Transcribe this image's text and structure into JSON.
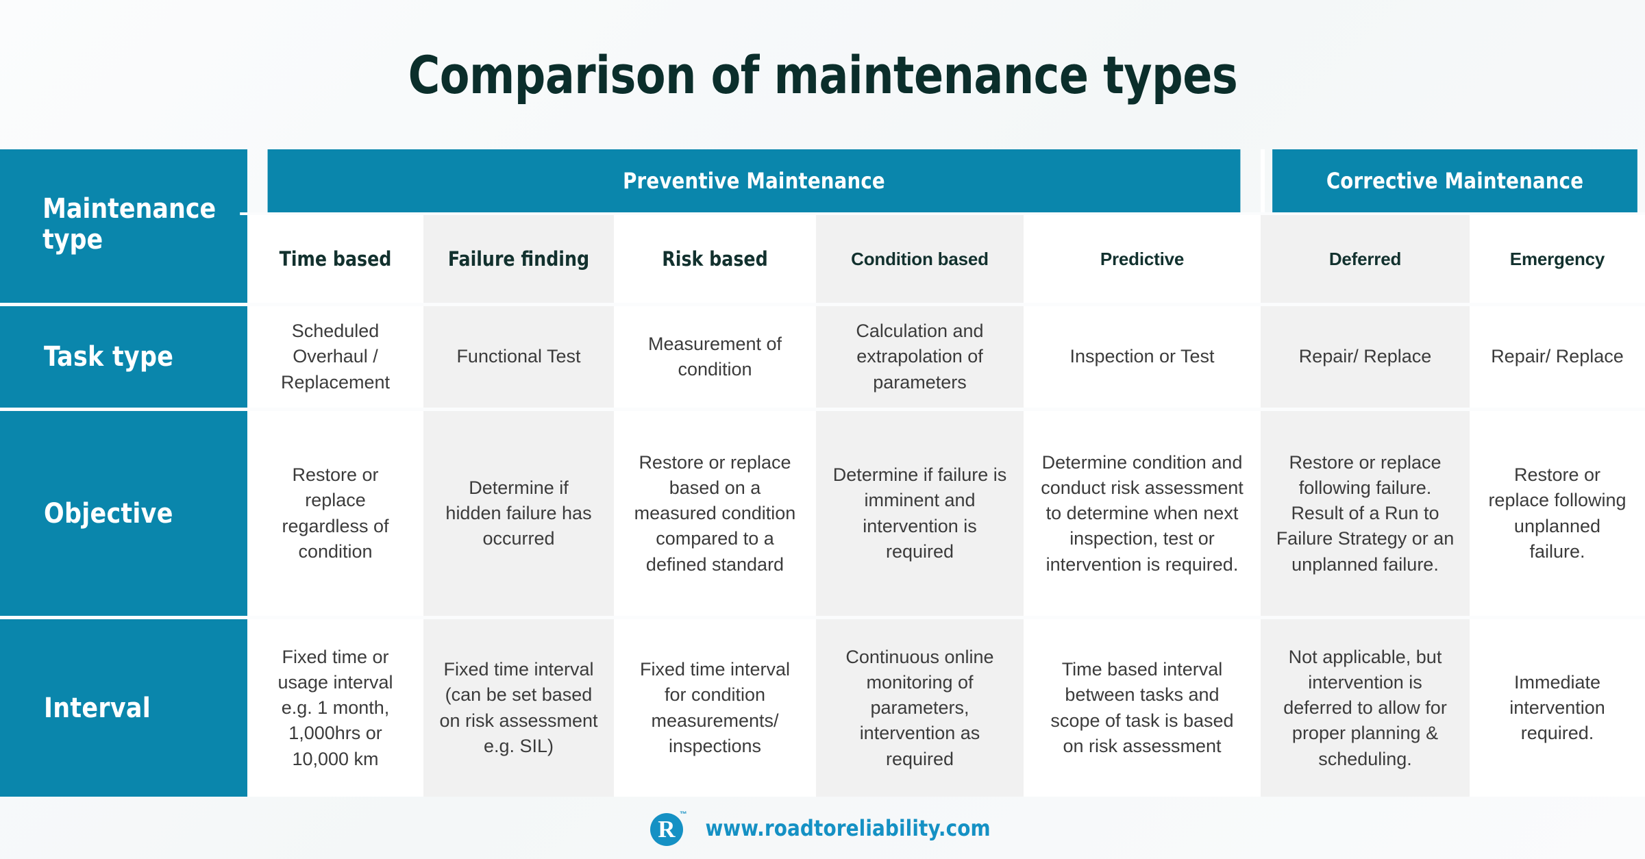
{
  "title": "Comparison of maintenance types",
  "colors": {
    "teal": "#0a86ac",
    "title_text": "#0b2e2b",
    "cell_text": "#3b3b3b",
    "stripe_gray": "#f1f1f1",
    "page_bg": "#f7f9fa",
    "link_blue": "#1591c4"
  },
  "table": {
    "corner_label": "Maintenance type",
    "groups": [
      {
        "label": "Preventive Maintenance",
        "span": 5
      },
      {
        "label": "Corrective Maintenance",
        "span": 2
      }
    ],
    "columns": [
      "Time based",
      "Failure finding",
      "Risk based",
      "Condition based",
      "Predictive",
      "Deferred",
      "Emergency"
    ],
    "rows": [
      {
        "label": "Task type",
        "cells": [
          "Scheduled Overhaul / Replacement",
          "Functional Test",
          "Measurement of condition",
          "Calculation and extrapolation of parameters",
          "Inspection or Test",
          "Repair/ Replace",
          "Repair/ Replace"
        ]
      },
      {
        "label": "Objective",
        "cells": [
          "Restore or replace regardless of condition",
          "Determine if hidden failure has occurred",
          "Restore or replace based on a measured condition compared to a defined standard",
          "Determine if failure is imminent and intervention is required",
          "Determine condition and conduct risk assessment to determine when next inspection, test or intervention is required.",
          "Restore or replace following failure. Result of a Run to Failure Strategy or an unplanned failure.",
          "Restore or replace following unplanned failure."
        ]
      },
      {
        "label": "Interval",
        "cells": [
          "Fixed time or usage interval e.g. 1 month, 1,000hrs or 10,000 km",
          "Fixed time interval (can be set based on risk assessment e.g. SIL)",
          "Fixed time interval for condition measurements/ inspections",
          "Continuous online monitoring of parameters, intervention as required",
          "Time based interval between tasks and scope of task is based on risk assessment",
          "Not applicable, but intervention is deferred to allow for proper planning & scheduling.",
          "Immediate intervention required."
        ]
      }
    ]
  },
  "footer": {
    "logo_letter": "R",
    "trademark": "™",
    "website": "www.roadtoreliability.com"
  }
}
